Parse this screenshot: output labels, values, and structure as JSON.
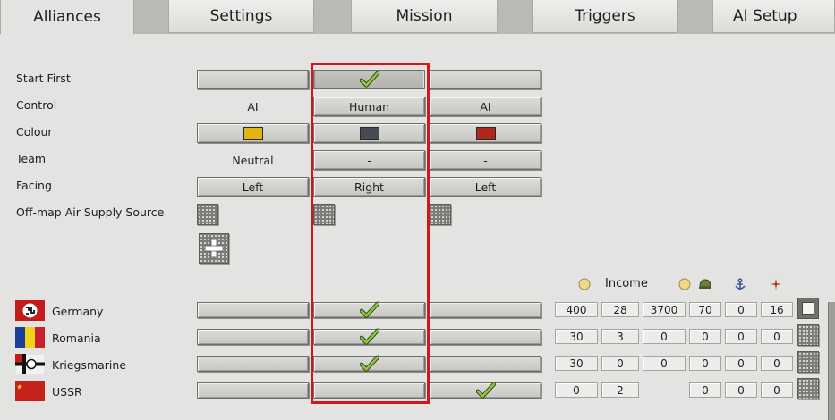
{
  "tabs": [
    {
      "label": "Alliances",
      "active": true
    },
    {
      "label": "Settings",
      "active": false
    },
    {
      "label": "Mission",
      "active": false
    },
    {
      "label": "Triggers",
      "active": false
    },
    {
      "label": "AI Setup",
      "active": false
    }
  ],
  "rows": {
    "start_first": "Start First",
    "control": "Control",
    "colour": "Colour",
    "team": "Team",
    "facing": "Facing",
    "air_supply": "Off-map Air Supply Source"
  },
  "players": [
    {
      "control": "AI",
      "colour": "#e2b60e",
      "team": "Neutral",
      "facing": "Left",
      "start_first": false
    },
    {
      "control": "Human",
      "colour": "#474c52",
      "team": "-",
      "facing": "Right",
      "start_first": true
    },
    {
      "control": "AI",
      "colour": "#b0261c",
      "team": "-",
      "facing": "Left",
      "start_first": false
    }
  ],
  "stats_header": {
    "income": "Income"
  },
  "sides": [
    {
      "name": "Germany",
      "assign": 1,
      "stats": [
        "400",
        "28",
        "3700",
        "70",
        "0",
        "16"
      ],
      "enabled": true
    },
    {
      "name": "Romania",
      "assign": 1,
      "stats": [
        "30",
        "3",
        "0",
        "0",
        "0",
        "0"
      ],
      "enabled": false
    },
    {
      "name": "Kriegsmarine",
      "assign": 1,
      "stats": [
        "30",
        "0",
        "0",
        "0",
        "0",
        "0"
      ],
      "enabled": false
    },
    {
      "name": "USSR",
      "assign": 2,
      "stats": [
        "0",
        "2",
        "",
        "0",
        "0",
        "0"
      ],
      "enabled": false
    }
  ],
  "colors": {
    "highlight": "#d4161b",
    "check": "#8cc63f"
  }
}
